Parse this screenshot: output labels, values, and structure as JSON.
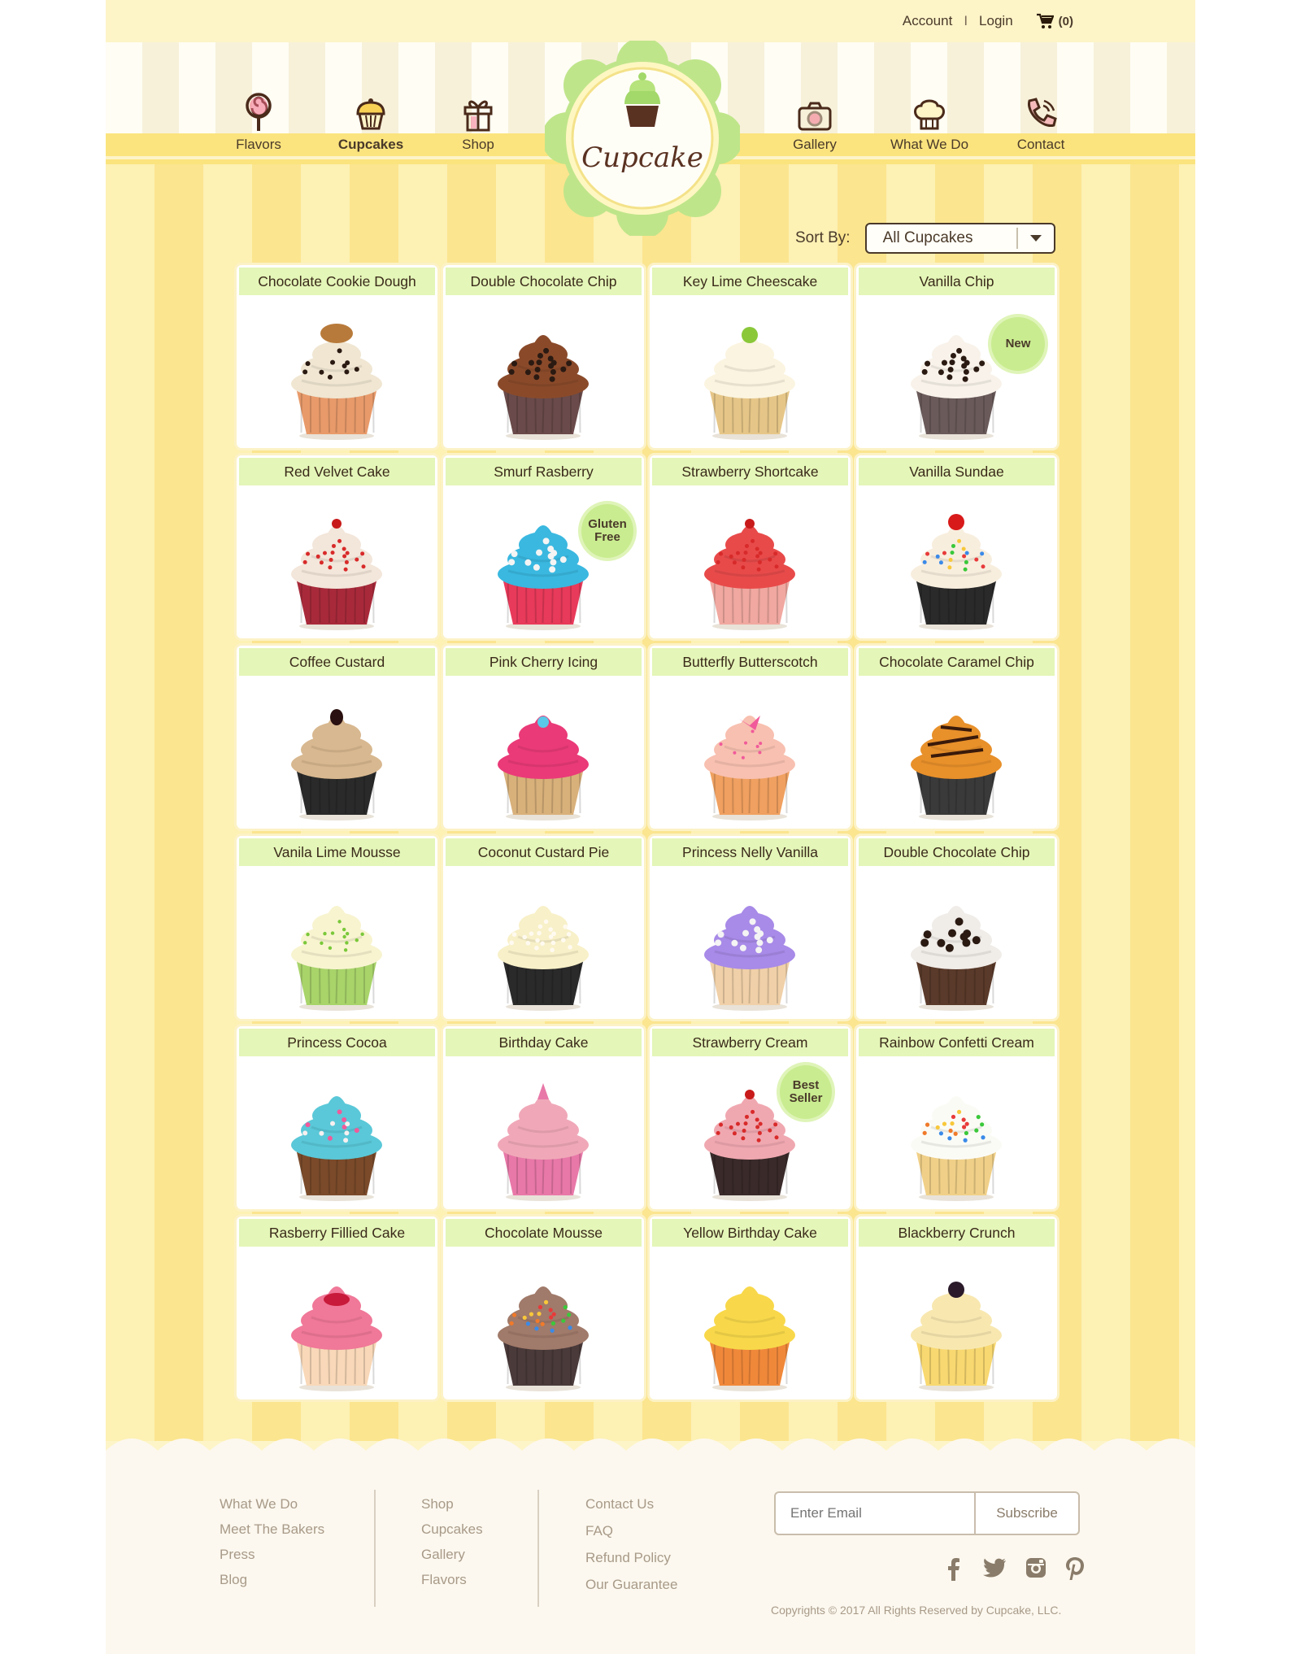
{
  "utility": {
    "account": "Account",
    "sep": "I",
    "login": "Login",
    "cart": "(0)"
  },
  "nav": {
    "left": [
      {
        "label": "Flavors",
        "icon": "lollipop-icon"
      },
      {
        "label": "Cupcakes",
        "icon": "cupcake-icon"
      },
      {
        "label": "Shop",
        "icon": "gift-icon"
      }
    ],
    "right": [
      {
        "label": "Gallery",
        "icon": "camera-icon"
      },
      {
        "label": "What We Do",
        "icon": "chef-hat-icon"
      },
      {
        "label": "Contact",
        "icon": "phone-icon"
      }
    ]
  },
  "logo": {
    "text": "Cupcake"
  },
  "sort": {
    "label": "Sort By:",
    "value": "All Cupcakes"
  },
  "products": [
    {
      "name": "Chocolate Cookie Dough",
      "frost": "#f0e6d2",
      "liner": "#e89a6a",
      "topping": "cookie"
    },
    {
      "name": "Double Chocolate Chip",
      "frost": "#8a4a2a",
      "liner": "#6a4a4a",
      "topping": "chips"
    },
    {
      "name": "Key Lime Cheescake",
      "frost": "#fbf4e0",
      "liner": "#e6c688",
      "topping": "lime"
    },
    {
      "name": "Vanilla Chip",
      "frost": "#f8f2ea",
      "liner": "#6a5a5a",
      "topping": "chips",
      "badge": "New"
    },
    {
      "name": "Red Velvet Cake",
      "frost": "#f3e6da",
      "liner": "#a82a3a",
      "topping": "sprinkle-red"
    },
    {
      "name": "Smurf Rasberry",
      "frost": "#3ab8e0",
      "liner": "#e83a5a",
      "topping": "pearls",
      "badge": "Gluten Free"
    },
    {
      "name": "Strawberry Shortcake",
      "frost": "#e84a4a",
      "liner": "#f0a8a0",
      "topping": "berry"
    },
    {
      "name": "Vanilla Sundae",
      "frost": "#f8eede",
      "liner": "#2a2a2a",
      "topping": "cherry"
    },
    {
      "name": "Coffee Custard",
      "frost": "#d8b890",
      "liner": "#2a2a2a",
      "topping": "bean"
    },
    {
      "name": "Pink Cherry Icing",
      "frost": "#ea3a78",
      "liner": "#d8b07a",
      "topping": "flower"
    },
    {
      "name": "Butterfly Butterscotch",
      "frost": "#f8c0b0",
      "liner": "#f0a060",
      "topping": "butterfly"
    },
    {
      "name": "Chocolate Caramel Chip",
      "frost": "#e8902a",
      "liner": "#3a3a3a",
      "topping": "drizzle"
    },
    {
      "name": "Vanila Lime Mousse",
      "frost": "#f8f4d0",
      "liner": "#a8d46a",
      "topping": "green"
    },
    {
      "name": "Coconut Custard Pie",
      "frost": "#f8f0c8",
      "liner": "#2a2a2a",
      "topping": "coconut"
    },
    {
      "name": "Princess Nelly Vanilla",
      "frost": "#a88ae8",
      "liner": "#f0d0a8",
      "topping": "pearls"
    },
    {
      "name": "Double Chocolate Chip",
      "frost": "#f0ece8",
      "liner": "#5a3a2a",
      "topping": "oreo"
    },
    {
      "name": "Princess Cocoa",
      "frost": "#5ac8d8",
      "liner": "#7a4a2a",
      "topping": "hearts"
    },
    {
      "name": "Birthday Cake",
      "frost": "#f0a8b8",
      "liner": "#e878a8",
      "topping": "pink"
    },
    {
      "name": "Strawberry Cream",
      "frost": "#f0a8b0",
      "liner": "#3a2a2a",
      "topping": "berry",
      "badge": "Best Seller"
    },
    {
      "name": "Rainbow Confetti Cream",
      "frost": "#fbfbf6",
      "liner": "#f0d088",
      "topping": "confetti"
    },
    {
      "name": "Rasberry Fillied Cake",
      "frost": "#f07898",
      "liner": "#f8d8b8",
      "topping": "rasp"
    },
    {
      "name": "Chocolate Mousse",
      "frost": "#a07a6a",
      "liner": "#4a3a3a",
      "topping": "confetti"
    },
    {
      "name": "Yellow Birthday Cake",
      "frost": "#f8d84a",
      "liner": "#f0883a",
      "topping": "none"
    },
    {
      "name": "Blackberry Crunch",
      "frost": "#f8e8b0",
      "liner": "#f8d870",
      "topping": "blackberry"
    }
  ],
  "footer": {
    "col1": [
      "What We Do",
      "Meet The Bakers",
      "Press",
      "Blog"
    ],
    "col2": [
      "Shop",
      "Cupcakes",
      "Gallery",
      "Flavors"
    ],
    "col3": [
      "Contact Us",
      "FAQ",
      "Refund Policy",
      "Our Guarantee"
    ],
    "email_placeholder": "Enter Email",
    "subscribe": "Subscribe",
    "social": [
      "facebook-icon",
      "twitter-icon",
      "instagram-icon",
      "pinterest-icon"
    ],
    "copyright": "Copyrights © 2017 All Rights Reserved by Cupcake, LLC."
  },
  "colors": {
    "accent_green": "#c9ec90",
    "band_yellow": "#fbe47e",
    "text_brown": "#4a3a2a"
  }
}
